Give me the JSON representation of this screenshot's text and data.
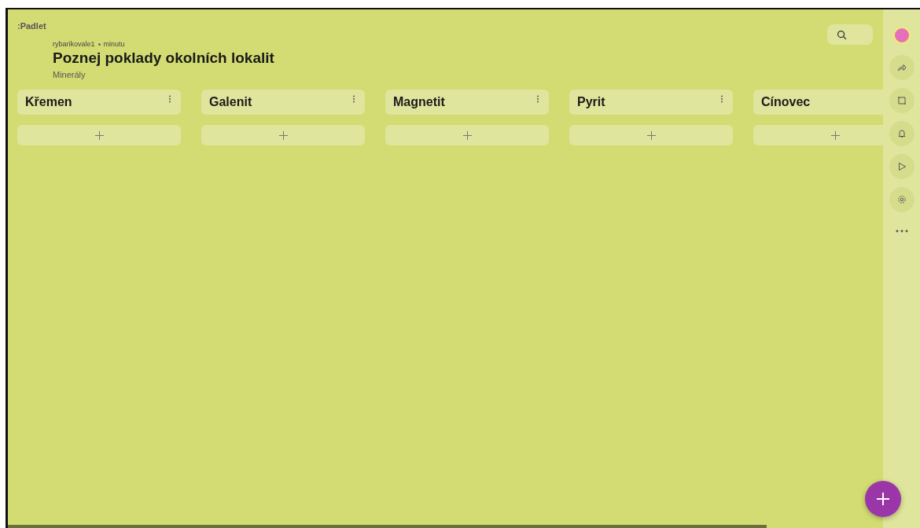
{
  "logo": ":Padlet",
  "author": {
    "name": "rybarikovale1",
    "time": "minutu"
  },
  "title": "Poznej poklady okolních lokalit",
  "subtitle": "Minerály",
  "columns": [
    {
      "title": "Křemen"
    },
    {
      "title": "Galenit"
    },
    {
      "title": "Magnetit"
    },
    {
      "title": "Pyrit"
    },
    {
      "title": "Cínovec"
    }
  ],
  "sidebar": [
    {
      "kind": "share"
    },
    {
      "kind": "remake"
    },
    {
      "kind": "bell"
    },
    {
      "kind": "play"
    },
    {
      "kind": "settings"
    },
    {
      "kind": "more"
    }
  ]
}
